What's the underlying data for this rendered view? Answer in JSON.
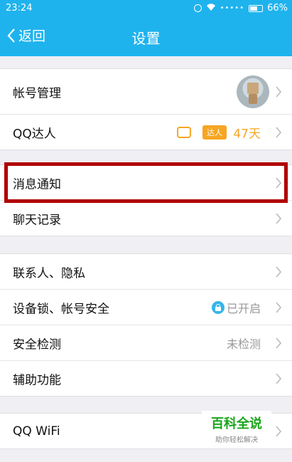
{
  "status": {
    "time": "23:24",
    "signal": "•••••",
    "battery": "66%"
  },
  "nav": {
    "back_label": "返回",
    "title": "设置"
  },
  "groups": [
    {
      "rows": [
        {
          "label": "帐号管理"
        },
        {
          "label": "QQ达人",
          "badge": "达人",
          "value": "47天"
        }
      ]
    },
    {
      "rows": [
        {
          "label": "消息通知"
        },
        {
          "label": "聊天记录"
        }
      ]
    },
    {
      "rows": [
        {
          "label": "联系人、隐私"
        },
        {
          "label": "设备锁、帐号安全",
          "value": "已开启"
        },
        {
          "label": "安全检测",
          "value": "未检测"
        },
        {
          "label": "辅助功能"
        }
      ]
    },
    {
      "rows": [
        {
          "label": "QQ WiFi"
        }
      ]
    }
  ],
  "watermark": {
    "title": "百科全说",
    "subtitle": "助你轻松解决"
  },
  "colors": {
    "header_bg": "#1fb3ee",
    "accent_orange": "#f5a623",
    "highlight_red": "#b00000",
    "watermark_green": "#1aa51a"
  }
}
